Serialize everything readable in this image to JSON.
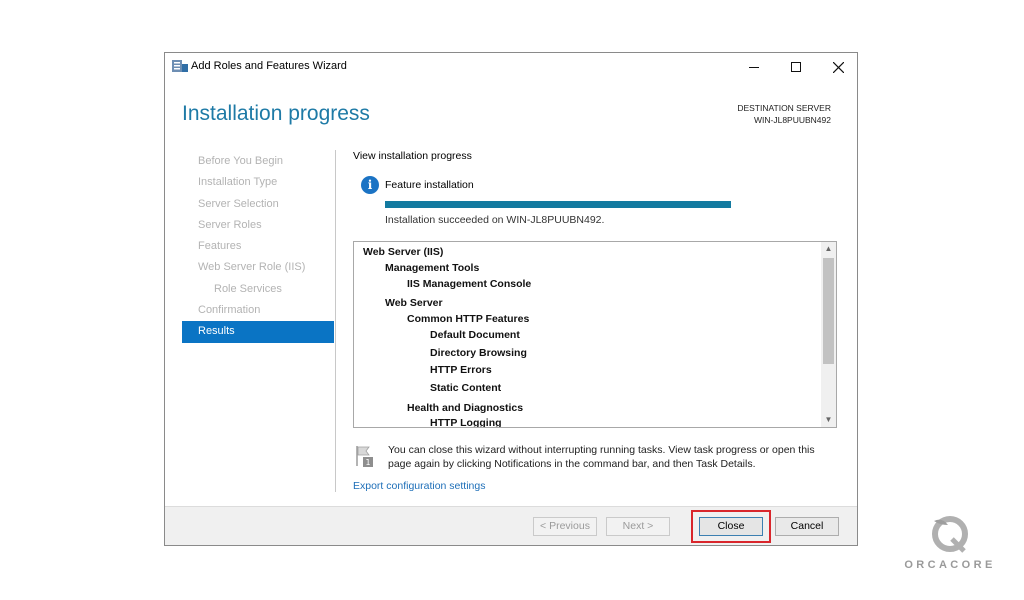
{
  "window": {
    "title": "Add Roles and Features Wizard",
    "controls": {
      "minimize": "—",
      "maximize": "☐",
      "close": "✕"
    }
  },
  "header": {
    "title": "Installation progress",
    "destination_label": "DESTINATION SERVER",
    "destination_server": "WIN-JL8PUUBN492"
  },
  "nav": {
    "items": [
      {
        "label": "Before You Begin"
      },
      {
        "label": "Installation Type"
      },
      {
        "label": "Server Selection"
      },
      {
        "label": "Server Roles"
      },
      {
        "label": "Features"
      },
      {
        "label": "Web Server Role (IIS)"
      },
      {
        "label": "Role Services"
      },
      {
        "label": "Confirmation"
      },
      {
        "label": "Results"
      }
    ]
  },
  "content": {
    "heading": "View installation progress",
    "feature_label": "Feature installation",
    "progress_percent": 100,
    "status": "Installation succeeded on WIN-JL8PUUBN492.",
    "results": [
      {
        "label": "Web Server (IIS)"
      },
      {
        "label": "Management Tools"
      },
      {
        "label": "IIS Management Console"
      },
      {
        "label": "Web Server"
      },
      {
        "label": "Common HTTP Features"
      },
      {
        "label": "Default Document"
      },
      {
        "label": "Directory Browsing"
      },
      {
        "label": "HTTP Errors"
      },
      {
        "label": "Static Content"
      },
      {
        "label": "Health and Diagnostics"
      },
      {
        "label": "HTTP Logging"
      }
    ],
    "note": "You can close this wizard without interrupting running tasks. View task progress or open this page again by clicking Notifications in the command bar, and then Task Details.",
    "export_link": "Export configuration settings"
  },
  "footer": {
    "previous": "< Previous",
    "next": "Next >",
    "close": "Close",
    "cancel": "Cancel"
  },
  "watermark": {
    "text": "ORCACORE"
  },
  "colors": {
    "accent": "#0a74c4",
    "title": "#1e7aa6",
    "progress": "#137aa0",
    "highlight": "#d9262c"
  }
}
